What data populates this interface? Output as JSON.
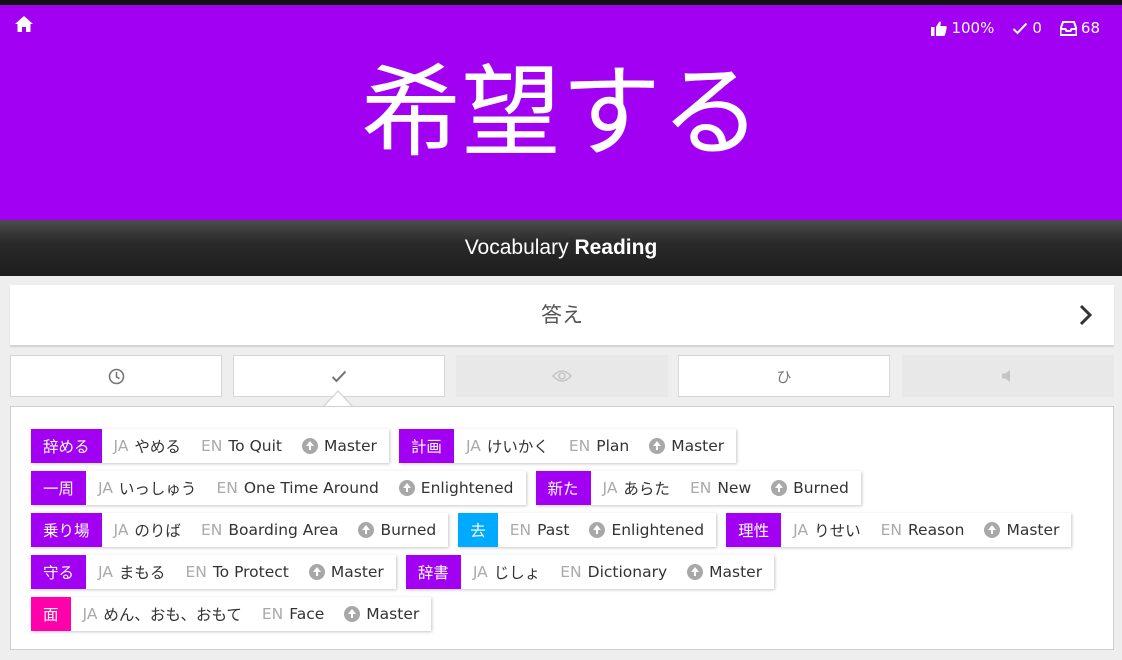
{
  "stats": {
    "percent": "100%",
    "correct": "0",
    "remaining": "68"
  },
  "prompt": {
    "kanji": "希望する"
  },
  "type_bar": {
    "category": "Vocabulary",
    "mode": "Reading"
  },
  "answer": {
    "placeholder": "答え"
  },
  "tabs": {
    "kana_label": "ひ"
  },
  "labels": {
    "ja": "JA",
    "en": "EN"
  },
  "colors": {
    "hero": "#a100f2",
    "vocabulary": "#a100f2",
    "kanji": "#ff00aa",
    "radical": "#00aaff"
  },
  "items": [
    {
      "characters": "辞める",
      "kind": "vocabulary",
      "ja": "やめる",
      "en": "To Quit",
      "srs": "Master"
    },
    {
      "characters": "計画",
      "kind": "vocabulary",
      "ja": "けいかく",
      "en": "Plan",
      "srs": "Master"
    },
    {
      "characters": "一周",
      "kind": "vocabulary",
      "ja": "いっしゅう",
      "en": "One Time Around",
      "srs": "Enlightened"
    },
    {
      "characters": "新た",
      "kind": "vocabulary",
      "ja": "あらた",
      "en": "New",
      "srs": "Burned"
    },
    {
      "characters": "乗り場",
      "kind": "vocabulary",
      "ja": "のりば",
      "en": "Boarding Area",
      "srs": "Burned"
    },
    {
      "characters": "去",
      "kind": "radical",
      "ja": "",
      "en": "Past",
      "srs": "Enlightened"
    },
    {
      "characters": "理性",
      "kind": "vocabulary",
      "ja": "りせい",
      "en": "Reason",
      "srs": "Master"
    },
    {
      "characters": "守る",
      "kind": "vocabulary",
      "ja": "まもる",
      "en": "To Protect",
      "srs": "Master"
    },
    {
      "characters": "辞書",
      "kind": "vocabulary",
      "ja": "じしょ",
      "en": "Dictionary",
      "srs": "Master"
    },
    {
      "characters": "面",
      "kind": "kanji",
      "ja": "めん、おも、おもて",
      "en": "Face",
      "srs": "Master"
    }
  ]
}
